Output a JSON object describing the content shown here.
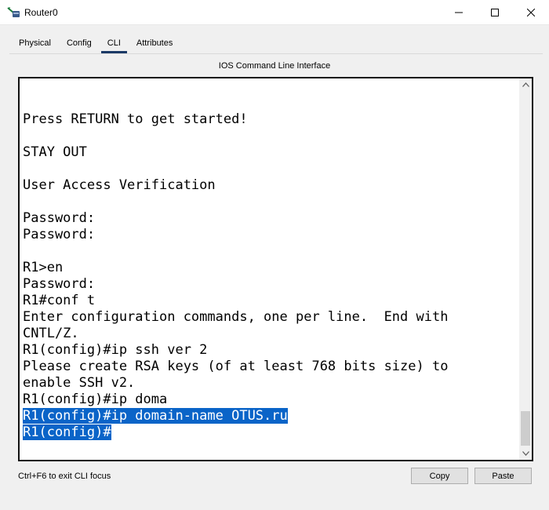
{
  "window": {
    "title": "Router0",
    "icon": "router-icon",
    "controls": [
      "minimize-icon",
      "maximize-icon",
      "close-icon"
    ]
  },
  "tabs": [
    {
      "label": "Physical",
      "active": false
    },
    {
      "label": "Config",
      "active": false
    },
    {
      "label": "CLI",
      "active": true
    },
    {
      "label": "Attributes",
      "active": false
    }
  ],
  "cli": {
    "header": "IOS Command Line Interface",
    "lines": [
      "",
      "",
      "Press RETURN to get started!",
      "",
      "STAY OUT",
      "",
      "User Access Verification",
      "",
      "Password:",
      "Password:",
      "",
      "R1>en",
      "Password:",
      "R1#conf t",
      "Enter configuration commands, one per line.  End with",
      "CNTL/Z.",
      "R1(config)#ip ssh ver 2",
      "Please create RSA keys (of at least 768 bits size) to",
      "enable SSH v2.",
      "R1(config)#ip doma",
      "R1(config)#ip domain-name OTUS.ru",
      "R1(config)#"
    ],
    "selected_lines": [
      20,
      21
    ],
    "selection_color": "#0a64c8"
  },
  "footer": {
    "hint": "Ctrl+F6 to exit CLI focus",
    "copy_label": "Copy",
    "paste_label": "Paste"
  }
}
